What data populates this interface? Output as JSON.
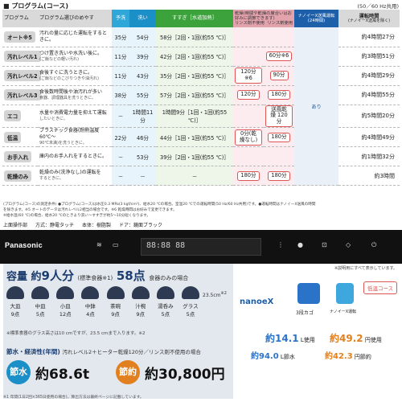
{
  "header": {
    "title": "■ プログラム(コース)",
    "frequency": "(50／60 Hz共用)"
  },
  "table": {
    "headers": {
      "program": "プログラム",
      "description": "プログラム選びのめやす",
      "pre_wash": "予洗",
      "wash": "洗い",
      "rinse": "すすぎ［水道加熱］",
      "dry": "乾燥(時間や乾燥の度合いはお好みに調節できます)",
      "dry_sub1": "リンス剤不使用",
      "dry_sub2": "リンス剤使用",
      "nano": "ナノイーX送風運転(24時間)",
      "time": "運転時間",
      "time_sub": "(ナノイーX送風を除く)"
    },
    "rows": [
      {
        "name": "オート※5",
        "desc": "汚れの量に応じた運転をするときに。",
        "sub": "",
        "pre": "35分",
        "wash": "54分",
        "rinse": "58分［2回・1回(約55 ℃)］",
        "dry1": "",
        "dry2": "",
        "time": "約4時間27分"
      },
      {
        "name": "汚れレベル1",
        "desc": "つけ置き洗いや水洗い後に。",
        "sub": "(ご飯などの軽い汚れ)",
        "pre": "11分",
        "wash": "39分",
        "rinse": "42分［2回・1回(約55 ℃)］",
        "dry1": "",
        "dry2": "60分※6",
        "time": "約3時間51分"
      },
      {
        "name": "汚れレベル2",
        "desc": "食後すぐに洗うときに。",
        "sub": "(ご飯などのこびりつきや油汚れ)",
        "pre": "11分",
        "wash": "43分",
        "rinse": "35分［2回・1回(約55 ℃)］",
        "dry1": "120分※6",
        "dry2": "90分",
        "time": "約4時間29分"
      },
      {
        "name": "汚れレベル3",
        "desc": "食後数時間後や油汚れが多い",
        "sub": "食器、調理器具を洗うときに。",
        "pre": "38分",
        "wash": "55分",
        "rinse": "57分［2回・1回(約55 ℃)］",
        "dry1": "120分",
        "dry2": "180分",
        "time": "約4時間55分"
      },
      {
        "name": "エコ",
        "desc": "水量や消費電力量を抑えて運転",
        "sub": "したいときに。",
        "pre": "－",
        "wash": "1時間11分",
        "rinse": "1時間9分［1回・1回(約55 ℃)］",
        "dry1": "",
        "dry2": "送風乾燥 120分",
        "time": "約5時間20分"
      },
      {
        "name": "低温",
        "desc": "プラスチック食器(耐熱温度60℃～",
        "sub": "90℃未満)を洗うときに。",
        "pre": "22分",
        "wash": "46分",
        "rinse": "44分［1回・1回(約55 ℃)］",
        "dry1": "0分(乾燥なし)",
        "dry2": "180分",
        "time": "約4時間49分"
      },
      {
        "name": "お手入れ",
        "desc": "庫内のお手入れをするときに。",
        "sub": "",
        "pre": "－",
        "wash": "53分",
        "rinse": "39分［2回・1回(約55 ℃)］",
        "dry1": "",
        "dry2": "",
        "time": "約1時間32分"
      },
      {
        "name": "乾燥のみ",
        "desc": "乾燥のみ(洗浄なし)の運転を",
        "sub": "するときに。",
        "pre": "－",
        "wash": "－",
        "rinse": "－",
        "dry1": "180分",
        "dry2": "180分",
        "time": "約3時間"
      }
    ],
    "nano_value": "あり",
    "dry_none_label": "0分(乾燥なし)"
  },
  "notes": [
    "(プログラム(コース)の測定条件) ●プログラム(コース)は水圧0.3 MPa(3 kgf/cm²)、給水20 ℃の場合。室温20 ℃での運転時間(50 Hz/60 Hz共用)です。●運転時間はナノイーX送風の時間",
    "を除きます。※5 オートのデータは汚れレベル2相当の場合です。※6 乾燥時間はお好みで変更できます。",
    "※給水温(60 ℃)の場合、給水20 ℃のときより洗い〜すすぎが約5〜10分短くなります。"
  ],
  "top_panel": {
    "label": "上面操作部",
    "switch": "方式：静電タッチ",
    "material": "本体：樹脂製",
    "door": "ドア：鏡面ブラック"
  },
  "control_panel": {
    "brand": "Panasonic",
    "display": "88:88 88",
    "display_note": "※説明用にすべて表示しています。"
  },
  "capacity": {
    "title_prefix": "容量 約",
    "persons": "9人分",
    "unit_note": "(標準食器※1)",
    "items": "58点",
    "items_suffix": "食器のみの場合",
    "height": "23.5cm",
    "height_note": "※2",
    "dishes": [
      {
        "name": "大皿",
        "count": "9点"
      },
      {
        "name": "中皿",
        "count": "5点"
      },
      {
        "name": "小皿",
        "count": "12点"
      },
      {
        "name": "中鉢",
        "count": "4点"
      },
      {
        "name": "茶碗",
        "count": "9点"
      },
      {
        "name": "汁椀",
        "count": "9点"
      },
      {
        "name": "湯呑み",
        "count": "5点"
      },
      {
        "name": "グラス",
        "count": "5点"
      }
    ],
    "note": "※標準食器のグラス高さは10 cmですが、23.5 cmまで入ります。※2"
  },
  "eco": {
    "title": "節水・経済性(年間)",
    "condition": "汚れレベル2＋ヒーター乾燥120分／リンス剤不使用の場合",
    "water_label": "節水",
    "water_value": "約68.6t",
    "money_label": "節約",
    "money_value": "約30,800円",
    "footnote": "※1 年間(1日2回×365日使用の場合)。算出方法は最終ページに記載しています。"
  },
  "features": {
    "nanoe": "nanoeX",
    "basket": "3段カゴ",
    "brand2": "ナノイーX運転",
    "low_temp": "低温コース",
    "water_use": "約14.1",
    "water_unit": "L使用",
    "water_save": "約94.0",
    "water_save_unit": "L節水",
    "energy_use": "約49.2",
    "energy_use_unit": "円使用",
    "energy_save": "約42.3",
    "energy_save_unit": "円節約"
  },
  "colors": {
    "pre_wash": "#2fa7d8",
    "wash": "#1b8fc7",
    "rinse": "#3ca33c",
    "dry": "#e3a3ad",
    "nano": "#1d5fa8",
    "water_circle": "#1b8fc7",
    "money_circle": "#e2801f"
  }
}
